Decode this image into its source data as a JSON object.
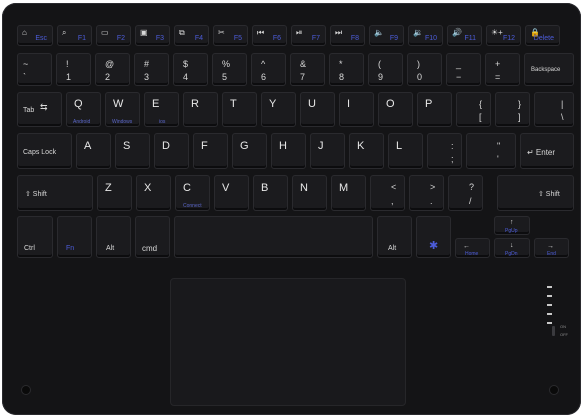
{
  "frow": [
    {
      "name": "esc-key",
      "top": "⌂",
      "fn": "Esc"
    },
    {
      "name": "f1-key",
      "top": "⌕",
      "fn": "F1"
    },
    {
      "name": "f2-key",
      "top": "▭",
      "fn": "F2"
    },
    {
      "name": "f3-key",
      "top": "▣",
      "fn": "F3"
    },
    {
      "name": "f4-key",
      "top": "⧉",
      "fn": "F4"
    },
    {
      "name": "f5-key",
      "top": "✂",
      "fn": "F5"
    },
    {
      "name": "f6-key",
      "top": "⏮",
      "fn": "F6"
    },
    {
      "name": "f7-key",
      "top": "⏯",
      "fn": "F7"
    },
    {
      "name": "f8-key",
      "top": "⏭",
      "fn": "F8"
    },
    {
      "name": "f9-key",
      "top": "🔈",
      "fn": "F9"
    },
    {
      "name": "f10-key",
      "top": "🔉",
      "fn": "F10"
    },
    {
      "name": "f11-key",
      "top": "🔊",
      "fn": "F11"
    },
    {
      "name": "f12-key",
      "top": "☀+",
      "fn": "F12"
    },
    {
      "name": "delete-key",
      "top": "🔒",
      "fn": "Delete"
    }
  ],
  "numrow": [
    {
      "name": "tilde-key",
      "top": "~",
      "bot": "`"
    },
    {
      "name": "key-1",
      "top": "!",
      "bot": "1"
    },
    {
      "name": "key-2",
      "top": "@",
      "bot": "2"
    },
    {
      "name": "key-3",
      "top": "#",
      "bot": "3"
    },
    {
      "name": "key-4",
      "top": "$",
      "bot": "4"
    },
    {
      "name": "key-5",
      "top": "%",
      "bot": "5"
    },
    {
      "name": "key-6",
      "top": "^",
      "bot": "6"
    },
    {
      "name": "key-7",
      "top": "&",
      "bot": "7"
    },
    {
      "name": "key-8",
      "top": "*",
      "bot": "8"
    },
    {
      "name": "key-9",
      "top": "(",
      "bot": "9"
    },
    {
      "name": "key-0",
      "top": ")",
      "bot": "0"
    },
    {
      "name": "minus-key",
      "top": "_",
      "bot": "−"
    },
    {
      "name": "equals-key",
      "top": "+",
      "bot": "="
    },
    {
      "name": "backspace-key",
      "label": "Backspace"
    }
  ],
  "qrow": [
    {
      "name": "tab-key",
      "label": "Tab"
    },
    {
      "name": "key-q",
      "main": "Q",
      "sub": "Android"
    },
    {
      "name": "key-w",
      "main": "W",
      "sub": "Windows"
    },
    {
      "name": "key-e",
      "main": "E",
      "sub": "ios"
    },
    {
      "name": "key-r",
      "main": "R"
    },
    {
      "name": "key-t",
      "main": "T"
    },
    {
      "name": "key-y",
      "main": "Y"
    },
    {
      "name": "key-u",
      "main": "U"
    },
    {
      "name": "key-i",
      "main": "I"
    },
    {
      "name": "key-o",
      "main": "O"
    },
    {
      "name": "key-p",
      "main": "P"
    },
    {
      "name": "lbrace-key",
      "top": "{",
      "bot": "["
    },
    {
      "name": "rbrace-key",
      "top": "}",
      "bot": "]"
    },
    {
      "name": "pipe-key",
      "top": "|",
      "bot": "\\"
    }
  ],
  "arow": [
    {
      "name": "capslock-key",
      "label": "Caps Lock"
    },
    {
      "name": "key-a",
      "main": "A"
    },
    {
      "name": "key-s",
      "main": "S"
    },
    {
      "name": "key-d",
      "main": "D"
    },
    {
      "name": "key-f",
      "main": "F"
    },
    {
      "name": "key-g",
      "main": "G"
    },
    {
      "name": "key-h",
      "main": "H"
    },
    {
      "name": "key-j",
      "main": "J"
    },
    {
      "name": "key-k",
      "main": "K"
    },
    {
      "name": "key-l",
      "main": "L"
    },
    {
      "name": "semicolon-key",
      "top": ":",
      "bot": ";"
    },
    {
      "name": "quote-key",
      "top": "\"",
      "bot": "'"
    },
    {
      "name": "enter-key",
      "label": "↵ Enter"
    }
  ],
  "zrow": [
    {
      "name": "lshift-key",
      "label": "⇧ Shift"
    },
    {
      "name": "key-z",
      "main": "Z"
    },
    {
      "name": "key-x",
      "main": "X"
    },
    {
      "name": "key-c",
      "main": "C",
      "sub": "Connect"
    },
    {
      "name": "key-v",
      "main": "V"
    },
    {
      "name": "key-b",
      "main": "B"
    },
    {
      "name": "key-n",
      "main": "N"
    },
    {
      "name": "key-m",
      "main": "M"
    },
    {
      "name": "comma-key",
      "top": "<",
      "bot": ","
    },
    {
      "name": "period-key",
      "top": ">",
      "bot": "."
    },
    {
      "name": "slash-key",
      "top": "?",
      "bot": "/"
    },
    {
      "name": "rshift-key",
      "label": "⇧ Shift"
    }
  ],
  "brow": {
    "ctrl": "Ctrl",
    "fn": "Fn",
    "alt": "Alt",
    "cmd": "cmd",
    "ralt": "Alt",
    "up_fn": "PgUp",
    "left_fn": "Home",
    "down_fn": "PgDn",
    "right_fn": "End"
  },
  "switch": {
    "on": "ON",
    "off": "OFF"
  },
  "colors": {
    "body": "#141416",
    "key": "#1b1b1e",
    "legend": "#e6e6e6",
    "fn_blue": "#4c5cd9"
  }
}
